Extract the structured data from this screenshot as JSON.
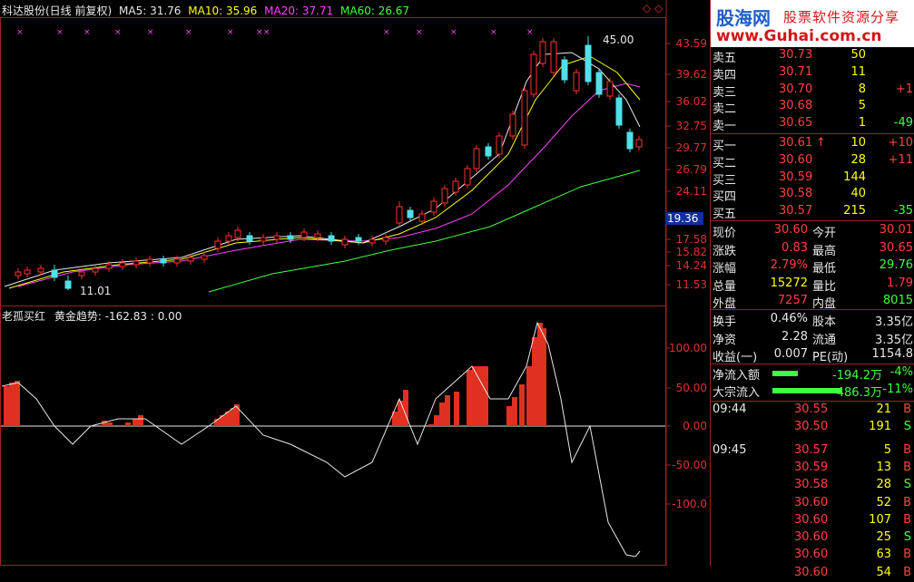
{
  "header": {
    "stock": "科达股份(日线 前复权)",
    "ma5_label": "MA5: 31.76",
    "ma10_label": "MA10: 35.96",
    "ma20_label": "MA20: 37.71",
    "ma60_label": "MA60: 26.67"
  },
  "price_axis": [
    "43.59",
    "39.62",
    "36.02",
    "32.75",
    "29.77",
    "26.79",
    "24.11",
    "19.36",
    "17.58",
    "15.82",
    "14.24",
    "11.53"
  ],
  "price_marks": {
    "high": "45.00",
    "low": "11.01"
  },
  "indicator": {
    "title": "老孤买红",
    "sub": "黄金趋势: -162.83 : 0.00",
    "axis": [
      "100.00",
      "50.00",
      "0.00",
      "-50.00",
      "-100.0"
    ]
  },
  "brand": {
    "name": "股海网",
    "slogan": "股票软件资源分享",
    "url": "www.Guhai.com.cn"
  },
  "orderbook": [
    {
      "label": "卖五",
      "price": "30.73",
      "vol": "50",
      "chg": ""
    },
    {
      "label": "卖四",
      "price": "30.71",
      "vol": "11",
      "chg": ""
    },
    {
      "label": "卖三",
      "price": "30.70",
      "vol": "8",
      "chg": "+1"
    },
    {
      "label": "卖二",
      "price": "30.68",
      "vol": "5",
      "chg": ""
    },
    {
      "label": "卖一",
      "price": "30.65",
      "vol": "1",
      "chg": "-49"
    },
    {
      "label": "买一",
      "price": "30.61",
      "vol": "10",
      "chg": "+10"
    },
    {
      "label": "买二",
      "price": "30.60",
      "vol": "28",
      "chg": "+11"
    },
    {
      "label": "买三",
      "price": "30.59",
      "vol": "144",
      "chg": ""
    },
    {
      "label": "买四",
      "price": "30.58",
      "vol": "40",
      "chg": ""
    },
    {
      "label": "买五",
      "price": "30.57",
      "vol": "215",
      "chg": "-35"
    }
  ],
  "quote": [
    {
      "l1": "现价",
      "v1": "30.60",
      "l2": "今开",
      "v2": "30.01"
    },
    {
      "l1": "涨跌",
      "v1": "0.83",
      "l2": "最高",
      "v2": "30.65"
    },
    {
      "l1": "涨幅",
      "v1": "2.79%",
      "l2": "最低",
      "v2": "29.76"
    },
    {
      "l1": "总量",
      "v1": "15272",
      "l2": "量比",
      "v2": "1.79"
    },
    {
      "l1": "外盘",
      "v1": "7257",
      "l2": "内盘",
      "v2": "8015"
    }
  ],
  "stats": [
    {
      "l1": "换手",
      "v1": "0.46%",
      "l2": "股本",
      "v2": "3.35亿"
    },
    {
      "l1": "净资",
      "v1": "2.28",
      "l2": "流通",
      "v2": "3.35亿"
    },
    {
      "l1": "收益(一)",
      "v1": "0.007",
      "l2": "PE(动)",
      "v2": "1154.8"
    }
  ],
  "flow": [
    {
      "label": "净流入额",
      "value": "-194.2万",
      "pct": "-4%",
      "bar": 0.2
    },
    {
      "label": "大宗流入",
      "value": "-486.3万",
      "pct": "-11%",
      "bar": 0.55
    }
  ],
  "ticks": [
    {
      "time": "09:44",
      "price": "30.55",
      "vol": "21",
      "side": "B"
    },
    {
      "time": "",
      "price": "30.50",
      "vol": "191",
      "side": "S"
    },
    {
      "time": "09:45",
      "price": "30.57",
      "vol": "5",
      "side": "B"
    },
    {
      "time": "",
      "price": "30.59",
      "vol": "13",
      "side": "B"
    },
    {
      "time": "",
      "price": "30.58",
      "vol": "28",
      "side": "S"
    },
    {
      "time": "",
      "price": "30.60",
      "vol": "52",
      "side": "B"
    },
    {
      "time": "",
      "price": "30.60",
      "vol": "107",
      "side": "B"
    },
    {
      "time": "",
      "price": "30.60",
      "vol": "25",
      "side": "S"
    },
    {
      "time": "",
      "price": "30.60",
      "vol": "63",
      "side": "B"
    },
    {
      "time": "",
      "price": "30.60",
      "vol": "54",
      "side": "B"
    }
  ]
}
